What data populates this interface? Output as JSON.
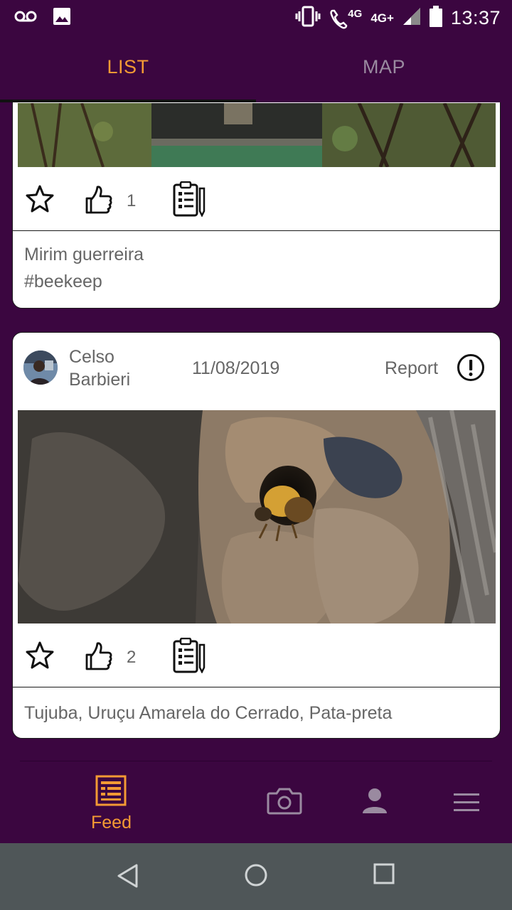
{
  "status_bar": {
    "time": "13:37",
    "network_1": "4G",
    "network_2": "4G+",
    "icons": [
      "voicemail-icon",
      "image-icon",
      "vibrate-icon",
      "wifi-call-icon",
      "signal-icon",
      "battery-icon"
    ]
  },
  "tabs": [
    {
      "label": "LIST",
      "active": true
    },
    {
      "label": "MAP",
      "active": false
    }
  ],
  "posts": [
    {
      "likes": "1",
      "caption_line1": "Mirim guerreira",
      "caption_line2": "#beekeep"
    },
    {
      "author_first": "Celso",
      "author_last": "Barbieri",
      "date": "11/08/2019",
      "report_label": "Report",
      "likes": "2",
      "caption": "Tujuba, Uruçu Amarela do Cerrado, Pata-preta"
    }
  ],
  "bottom_nav": {
    "feed_label": "Feed",
    "items": [
      "feed-icon",
      "camera-icon",
      "profile-icon",
      "menu-icon"
    ]
  },
  "colors": {
    "background": "#3b0640",
    "accent": "#f39a34",
    "system_bar": "#4f5658"
  }
}
